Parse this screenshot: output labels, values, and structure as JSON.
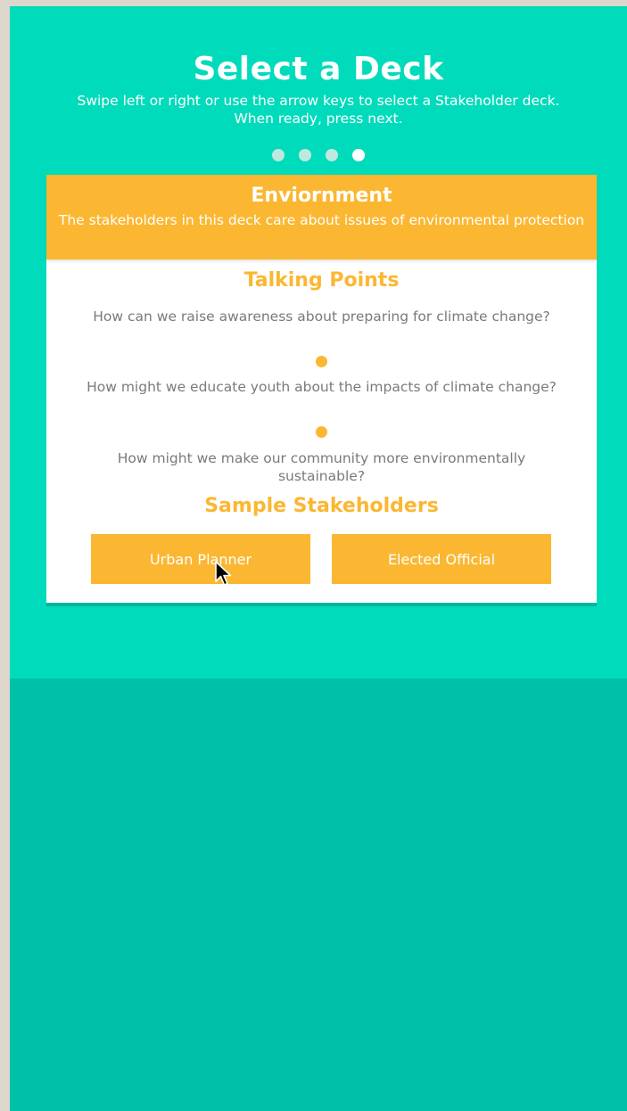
{
  "header": {
    "title": "Select a Deck",
    "instructions_line1": "Swipe left or right or use the arrow keys to select a Stakeholder deck.",
    "instructions_line2": "When ready, press next."
  },
  "pagination": {
    "total": 4,
    "active_index": 3
  },
  "deck": {
    "name": "Enviornment",
    "description": "The stakeholders in this deck care about issues of environmental protection",
    "talking_points_title": "Talking Points",
    "talking_points": [
      "How can we raise awareness about preparing for climate change?",
      "How might we educate youth about the impacts of climate change?",
      "How might we make our community more environmentally sustainable?"
    ],
    "stakeholders_title": "Sample Stakeholders",
    "stakeholders": [
      "Urban Planner",
      "Elected Official"
    ]
  },
  "colors": {
    "top_background": "#00dbbb",
    "bottom_background": "#00c0aa",
    "accent": "#fbb732",
    "text_gray": "#7a7a7a"
  }
}
